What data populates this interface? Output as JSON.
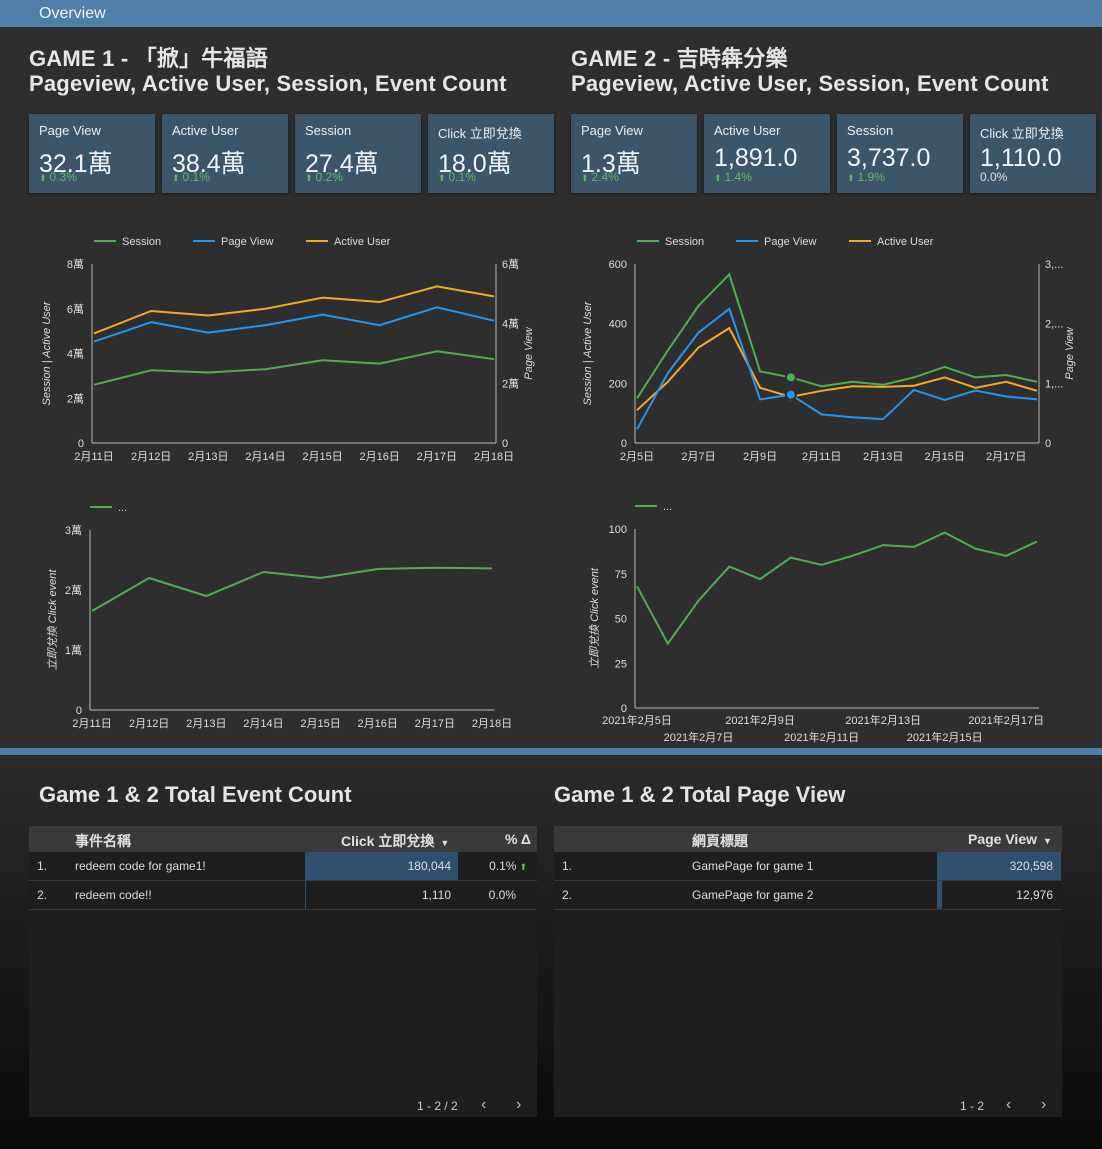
{
  "header": {
    "title": "Overview"
  },
  "game1": {
    "title": "GAME 1 - 「掀」牛福語",
    "subtitle": "Pageview, Active User, Session, Event Count",
    "scorecards": [
      {
        "label": "Page View",
        "value": "32.1萬",
        "delta": "0.3%",
        "trend": "up"
      },
      {
        "label": "Active User",
        "value": "38.4萬",
        "delta": "0.1%",
        "trend": "up"
      },
      {
        "label": "Session",
        "value": "27.4萬",
        "delta": "0.2%",
        "trend": "up"
      },
      {
        "label": "Click 立即兌換",
        "value": "18.0萬",
        "delta": "0.1%",
        "trend": "up"
      }
    ]
  },
  "game2": {
    "title": "GAME 2 - 吉時犇分樂",
    "subtitle": "Pageview, Active User, Session, Event Count",
    "scorecards": [
      {
        "label": "Page View",
        "value": "1.3萬",
        "delta": "2.4%",
        "trend": "up"
      },
      {
        "label": "Active User",
        "value": "1,891.0",
        "delta": "1.4%",
        "trend": "up"
      },
      {
        "label": "Session",
        "value": "3,737.0",
        "delta": "1.9%",
        "trend": "up"
      },
      {
        "label": "Click 立即兌換",
        "value": "1,110.0",
        "delta": "0.0%",
        "trend": "none"
      }
    ]
  },
  "colors": {
    "session": "#4caf50",
    "pageview": "#2196f3",
    "active_user": "#f9a825",
    "click": "#4caf50",
    "accent": "#4f7fa8"
  },
  "chart_data": [
    {
      "type": "line",
      "x": [
        "2月11日",
        "2月12日",
        "2月13日",
        "2月14日",
        "2月15日",
        "2月16日",
        "2月17日",
        "2月18日"
      ],
      "legend": [
        "Session",
        "Page View",
        "Active User"
      ],
      "ylabel": "Session | Active User",
      "y2label": "Page View",
      "yticks": [
        "0",
        "2萬",
        "4萬",
        "6萬",
        "8萬"
      ],
      "y2ticks": [
        "0",
        "2萬",
        "4萬",
        "6萬"
      ],
      "ylim": [
        0,
        80000
      ],
      "y2lim": [
        0,
        60000
      ],
      "series": [
        {
          "name": "Session",
          "axis": "left",
          "values": [
            26000,
            32500,
            31500,
            33000,
            37000,
            35500,
            41000,
            37500
          ]
        },
        {
          "name": "Active User",
          "axis": "left",
          "values": [
            49000,
            59000,
            57000,
            60000,
            65000,
            63000,
            70000,
            65500
          ]
        },
        {
          "name": "Page View",
          "axis": "right",
          "values": [
            34000,
            40500,
            37000,
            39500,
            43000,
            39500,
            45500,
            41000
          ]
        }
      ]
    },
    {
      "type": "line",
      "x": [
        "2021-02-05",
        "2021-02-06",
        "2021-02-07",
        "2021-02-08",
        "2021-02-09",
        "2021-02-10",
        "2021-02-11",
        "2021-02-12",
        "2021-02-13",
        "2021-02-14",
        "2021-02-15",
        "2021-02-16",
        "2021-02-17",
        "2021-02-18"
      ],
      "xticks": [
        "2月5日",
        "2月7日",
        "2月9日",
        "2月11日",
        "2月13日",
        "2月15日",
        "2月17日"
      ],
      "legend": [
        "Session",
        "Page View",
        "Active User"
      ],
      "ylabel": "Session | Active User",
      "y2label": "Page View",
      "yticks": [
        "0",
        "200",
        "400",
        "600"
      ],
      "y2ticks": [
        "0",
        "1,...",
        "2,...",
        "3,..."
      ],
      "ylim": [
        0,
        600
      ],
      "y2lim": [
        0,
        3000
      ],
      "series": [
        {
          "name": "Session",
          "axis": "left",
          "values": [
            150,
            310,
            460,
            565,
            240,
            220,
            190,
            205,
            195,
            220,
            255,
            220,
            228,
            205
          ]
        },
        {
          "name": "Active User",
          "axis": "left",
          "values": [
            110,
            205,
            320,
            385,
            185,
            155,
            175,
            190,
            188,
            192,
            220,
            185,
            205,
            175
          ]
        },
        {
          "name": "Page View",
          "axis": "right",
          "values": [
            230,
            1170,
            1850,
            2250,
            730,
            810,
            480,
            430,
            400,
            890,
            720,
            880,
            780,
            730
          ]
        }
      ]
    },
    {
      "type": "line",
      "x": [
        "2月11日",
        "2月12日",
        "2月13日",
        "2月14日",
        "2月15日",
        "2月16日",
        "2月17日",
        "2月18日"
      ],
      "legend": [
        "..."
      ],
      "ylabel": "立即兌換 Click event",
      "yticks": [
        "0",
        "1萬",
        "2萬",
        "3萬"
      ],
      "ylim": [
        0,
        30000
      ],
      "series": [
        {
          "name": "立即兌換 Click event",
          "values": [
            16500,
            22000,
            19000,
            23000,
            22000,
            23500,
            23700,
            23600
          ]
        }
      ]
    },
    {
      "type": "line",
      "x": [
        "2021-02-05",
        "2021-02-06",
        "2021-02-07",
        "2021-02-08",
        "2021-02-09",
        "2021-02-10",
        "2021-02-11",
        "2021-02-12",
        "2021-02-13",
        "2021-02-14",
        "2021-02-15",
        "2021-02-16",
        "2021-02-17",
        "2021-02-18"
      ],
      "xticks_top": [
        "2021年2月5日",
        "2021年2月9日",
        "2021年2月13日",
        "2021年2月17日"
      ],
      "xticks_bottom": [
        "2021年2月7日",
        "2021年2月11日",
        "2021年2月15日"
      ],
      "legend": [
        "..."
      ],
      "ylabel": "立即兌換 Click event",
      "yticks": [
        "0",
        "25",
        "50",
        "75",
        "100"
      ],
      "ylim": [
        0,
        100
      ],
      "series": [
        {
          "name": "立即兌換 Click event",
          "values": [
            68,
            36,
            60,
            79,
            72,
            84,
            80,
            85,
            91,
            90,
            98,
            89,
            85,
            93
          ]
        }
      ]
    }
  ],
  "event_table": {
    "title": "Game 1 & 2 Total Event Count",
    "headers": {
      "name": "事件名稱",
      "metric": "Click 立即兌換",
      "delta": "% Δ"
    },
    "rows": [
      {
        "idx": "1.",
        "name": "redeem code for game1!",
        "value": "180,044",
        "delta": "0.1%",
        "bar": 1.0,
        "gain": true
      },
      {
        "idx": "2.",
        "name": "redeem code!!",
        "value": "1,110",
        "delta": "0.0%",
        "bar": 0.006,
        "gain": false
      }
    ],
    "pager": "1 - 2 / 2"
  },
  "page_table": {
    "title": "Game 1 & 2 Total Page View",
    "headers": {
      "name": "網頁標題",
      "metric": "Page View"
    },
    "rows": [
      {
        "idx": "1.",
        "name": "GamePage for game 1",
        "value": "320,598",
        "bar": 1.0
      },
      {
        "idx": "2.",
        "name": "GamePage for game 2",
        "value": "12,976",
        "bar": 0.04
      }
    ],
    "pager": "1 - 2"
  }
}
